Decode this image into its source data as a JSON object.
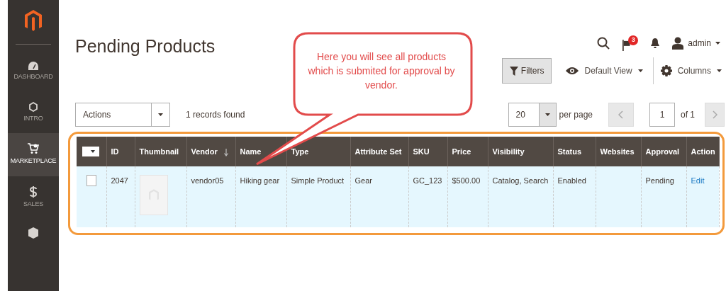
{
  "sidebar": {
    "items": [
      {
        "label": "DASHBOARD",
        "selected": false
      },
      {
        "label": "INTRO",
        "selected": false
      },
      {
        "label": "MARKETPLACE",
        "selected": true
      },
      {
        "label": "SALES",
        "selected": false
      }
    ]
  },
  "header": {
    "title": "Pending Products",
    "notification_count": "3",
    "user": "admin"
  },
  "callout": {
    "text": "Here you will see all products which is submited for approval by vendor."
  },
  "toolbar": {
    "filters": "Filters",
    "view": "Default View",
    "columns": "Columns"
  },
  "grid_controls": {
    "actions": "Actions",
    "records": "1 records found",
    "per_page_value": "20",
    "per_page_label": "per page",
    "page": "1",
    "page_total": "of 1"
  },
  "table": {
    "mass_select": {
      "checked": false
    },
    "columns": [
      {
        "label": "ID",
        "sorted": false
      },
      {
        "label": "Thumbnail",
        "sorted": false
      },
      {
        "label": "Vendor",
        "sorted": true
      },
      {
        "label": "Name",
        "sorted": false
      },
      {
        "label": "Type",
        "sorted": false
      },
      {
        "label": "Attribute Set",
        "sorted": false
      },
      {
        "label": "SKU",
        "sorted": false
      },
      {
        "label": "Price",
        "sorted": false
      },
      {
        "label": "Visibility",
        "sorted": false
      },
      {
        "label": "Status",
        "sorted": false
      },
      {
        "label": "Websites",
        "sorted": false
      },
      {
        "label": "Approval",
        "sorted": false
      },
      {
        "label": "Action",
        "sorted": false
      }
    ],
    "rows": [
      {
        "checked": false,
        "id": "2047",
        "vendor": "vendor05",
        "name": "Hiking gear",
        "type": "Simple Product",
        "attribute_set": "Gear",
        "sku": "GC_123",
        "price": "$500.00",
        "visibility": "Catalog, Search",
        "status": "Enabled",
        "approval": "Pending",
        "action": "Edit"
      }
    ]
  }
}
